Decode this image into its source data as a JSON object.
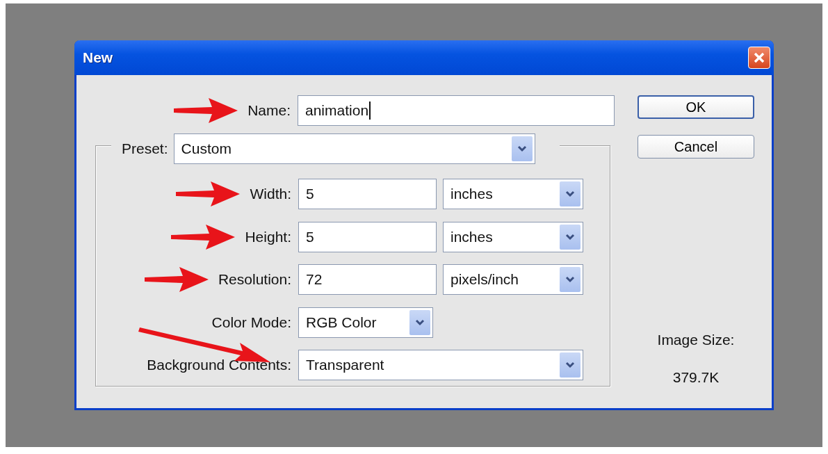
{
  "window": {
    "title": "New"
  },
  "name_field": {
    "label": "Name:",
    "value": "animation",
    "focused": true,
    "arrow": true
  },
  "preset": {
    "label": "Preset:",
    "value": "Custom"
  },
  "fields": [
    {
      "kind": "text_unit",
      "label": "Width:",
      "value": "5",
      "unit": "inches",
      "arrow": true
    },
    {
      "kind": "text_unit",
      "label": "Height:",
      "value": "5",
      "unit": "inches",
      "arrow": true
    },
    {
      "kind": "text_unit",
      "label": "Resolution:",
      "value": "72",
      "unit": "pixels/inch",
      "arrow": true
    },
    {
      "kind": "dropdown",
      "label": "Color Mode:",
      "value": "RGB Color",
      "arrow": false
    },
    {
      "kind": "dropdown_wide",
      "label": "Background Contents:",
      "value": "Transparent",
      "arrow": true
    }
  ],
  "buttons": [
    {
      "label": "OK",
      "default": true
    },
    {
      "label": "Cancel",
      "default": false
    }
  ],
  "image_size": {
    "label": "Image Size:",
    "value": "379.7K"
  }
}
